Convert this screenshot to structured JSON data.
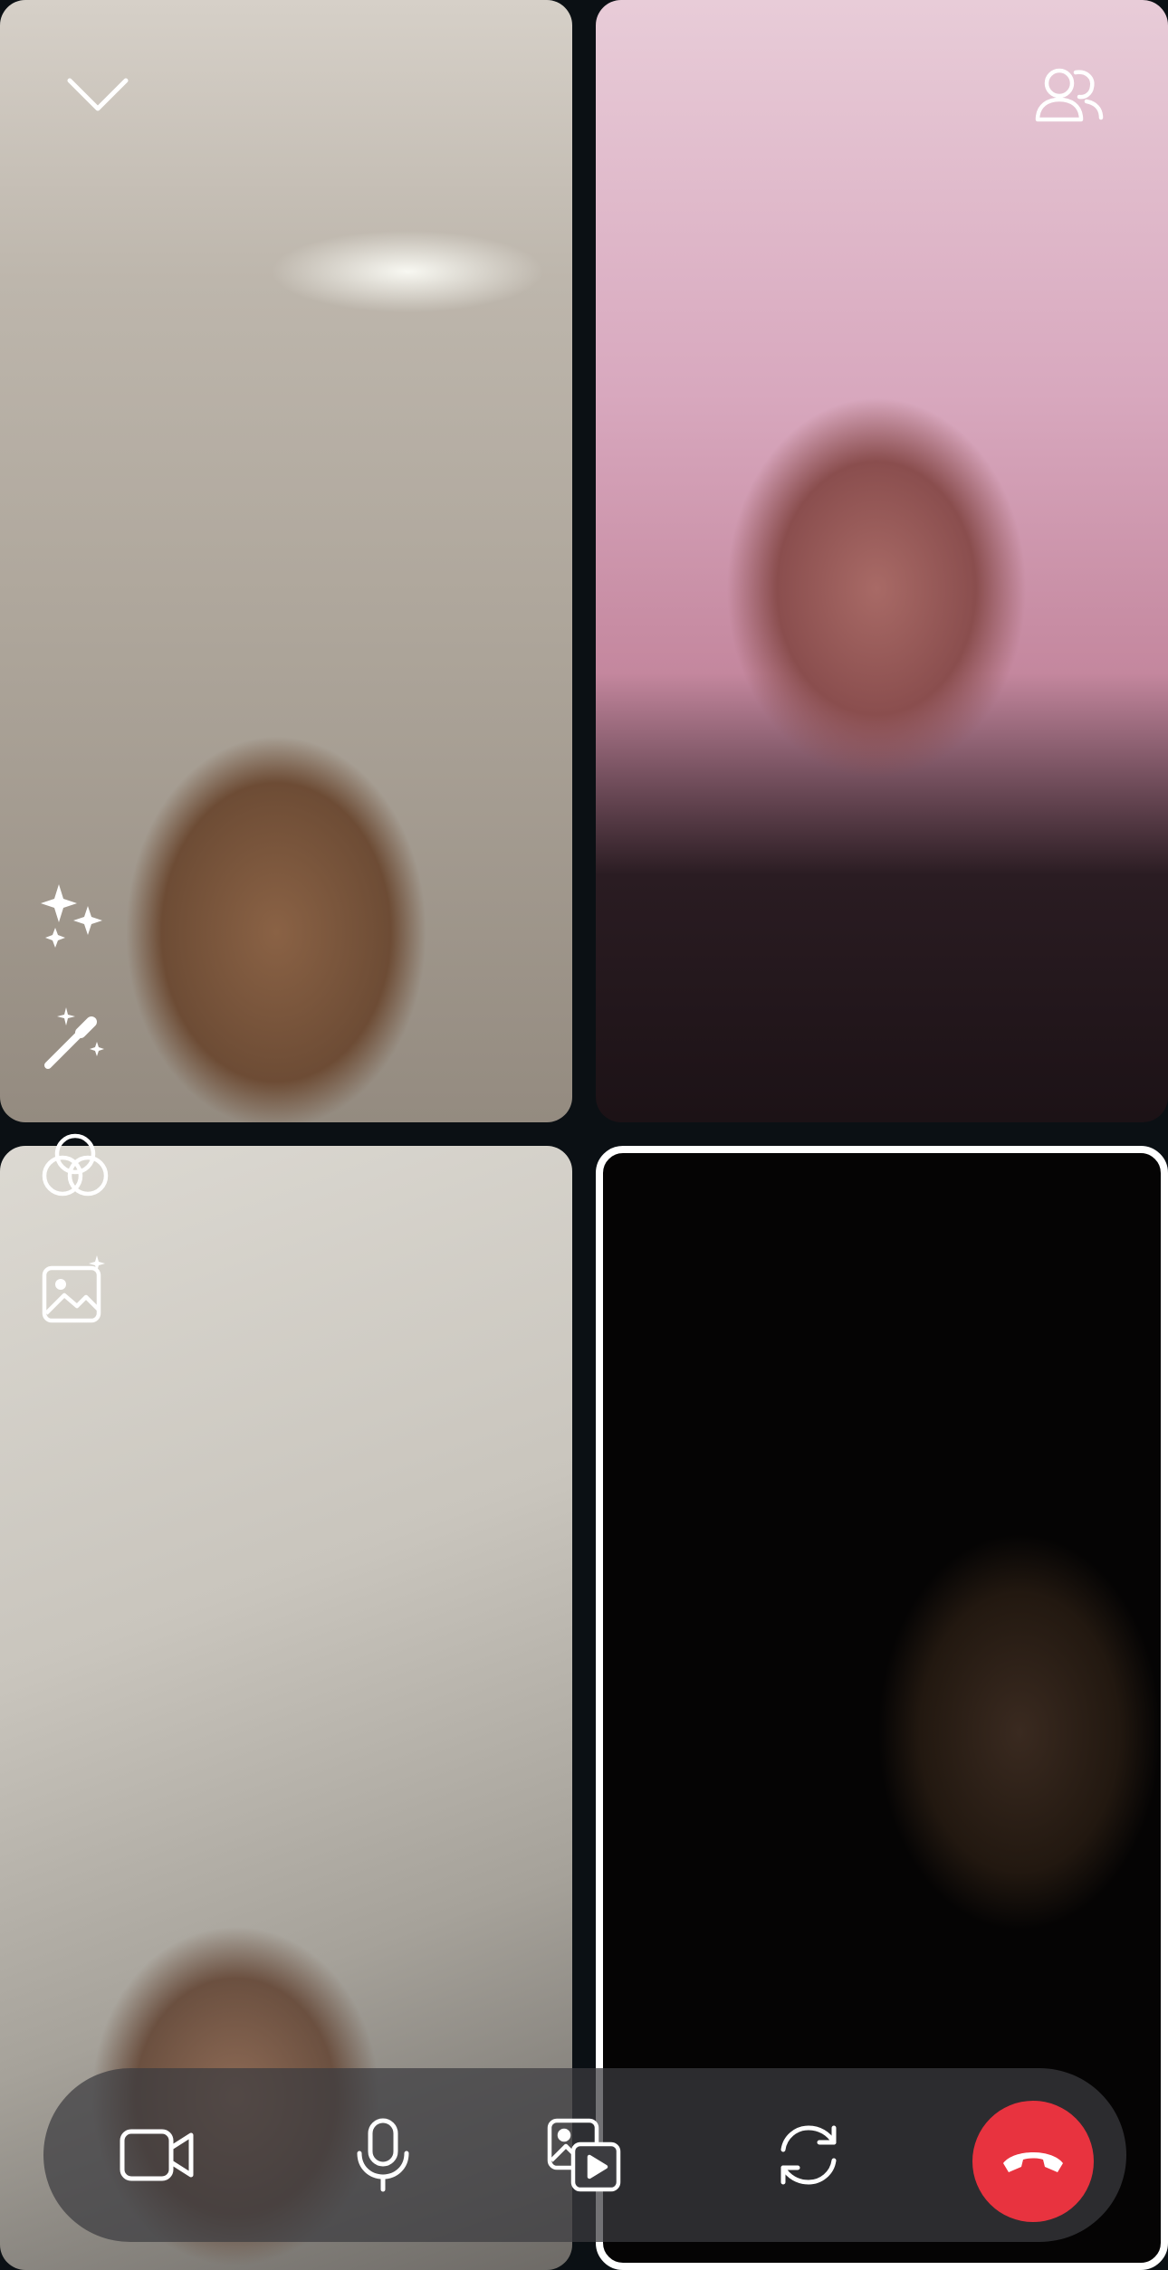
{
  "call": {
    "participants": [
      {
        "id": "participant-top-left"
      },
      {
        "id": "participant-top-right"
      },
      {
        "id": "participant-bottom-left"
      },
      {
        "id": "participant-self",
        "highlighted": true
      }
    ]
  },
  "top_controls": {
    "minimize_icon": "chevron-down-icon",
    "participants_icon": "people-icon"
  },
  "side_tools": [
    "sparkles-icon",
    "magic-wand-icon",
    "color-filter-icon",
    "image-sparkle-icon"
  ],
  "bottom_bar": {
    "buttons": [
      "video-camera-icon",
      "microphone-icon",
      "media-share-icon",
      "flip-camera-icon",
      "end-call-icon"
    ]
  },
  "colors": {
    "end_call": "#e8333f",
    "self_border": "#ffffff",
    "control_bar": "rgba(60,60,64,0.72)"
  }
}
